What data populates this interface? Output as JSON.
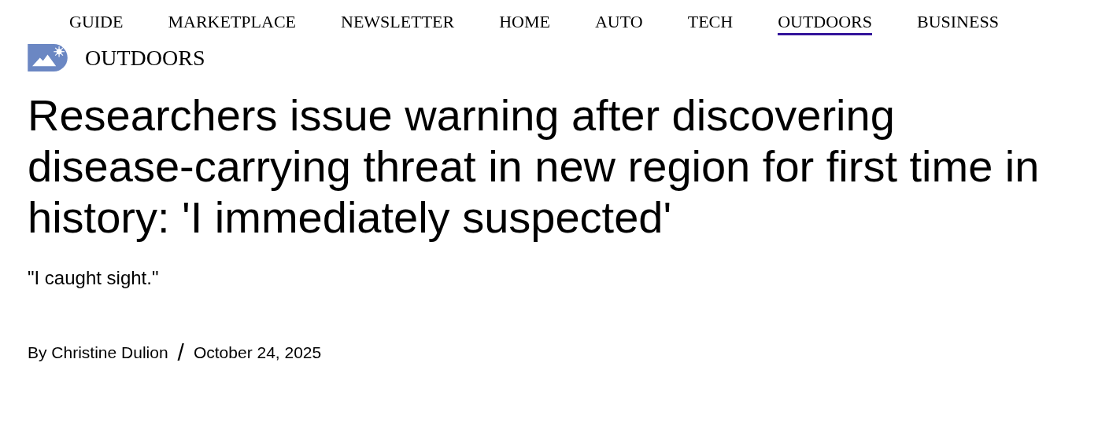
{
  "nav": [
    {
      "label": "GUIDE",
      "selected": false
    },
    {
      "label": "MARKETPLACE",
      "selected": false
    },
    {
      "label": "NEWSLETTER",
      "selected": false
    },
    {
      "label": "HOME",
      "selected": false
    },
    {
      "label": "AUTO",
      "selected": false
    },
    {
      "label": "TECH",
      "selected": false
    },
    {
      "label": "OUTDOORS",
      "selected": true
    },
    {
      "label": "BUSINESS",
      "selected": false
    }
  ],
  "section": {
    "label": "OUTDOORS"
  },
  "headline": "Researchers issue warning after discovering disease-carrying threat in new region for first time in history: 'I immediately suspected'",
  "subtitle": "\"I caught sight.\"",
  "byline": {
    "author": "By Christine Dulion",
    "separator": "/",
    "date": "October 24, 2025"
  }
}
